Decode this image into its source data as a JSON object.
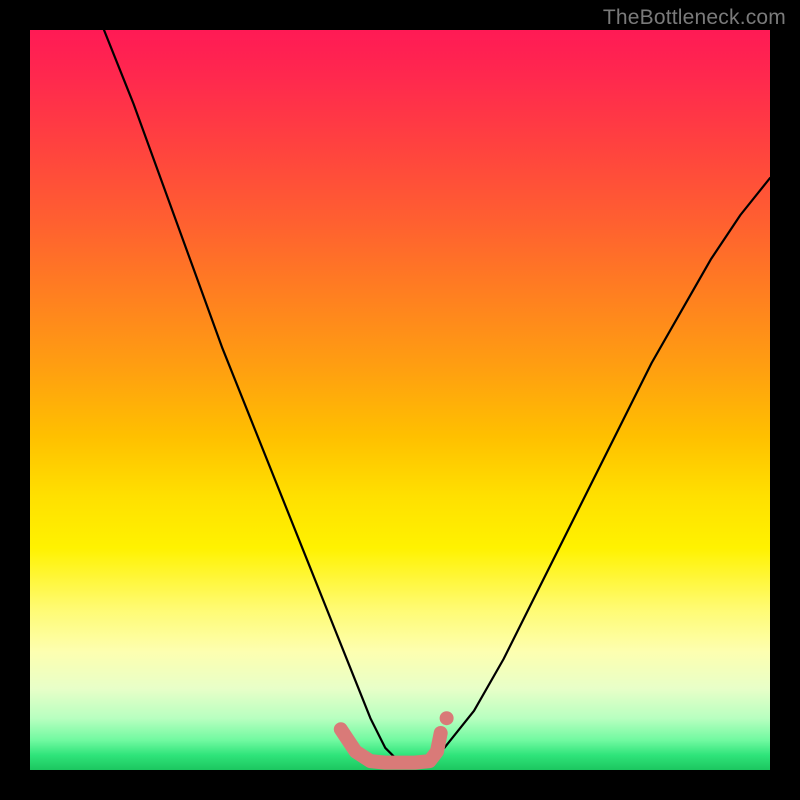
{
  "watermark": "TheBottleneck.com",
  "chart_data": {
    "type": "line",
    "title": "",
    "xlabel": "",
    "ylabel": "",
    "xlim": [
      0,
      100
    ],
    "ylim": [
      0,
      100
    ],
    "background_gradient": {
      "direction": "vertical",
      "stops": [
        {
          "t": 0.0,
          "color": "#ff1a55"
        },
        {
          "t": 0.15,
          "color": "#ff4040"
        },
        {
          "t": 0.36,
          "color": "#ff8020"
        },
        {
          "t": 0.55,
          "color": "#ffc000"
        },
        {
          "t": 0.7,
          "color": "#fff200"
        },
        {
          "t": 0.84,
          "color": "#fdffb0"
        },
        {
          "t": 0.93,
          "color": "#b8ffc0"
        },
        {
          "t": 1.0,
          "color": "#1cc65f"
        }
      ]
    },
    "series": [
      {
        "name": "bottleneck-curve",
        "color": "#000000",
        "x": [
          10,
          14,
          18,
          22,
          26,
          30,
          34,
          38,
          42,
          44,
          46,
          48,
          50,
          52,
          54,
          56,
          60,
          64,
          68,
          72,
          76,
          80,
          84,
          88,
          92,
          96,
          100
        ],
        "y": [
          100,
          90,
          79,
          68,
          57,
          47,
          37,
          27,
          17,
          12,
          7,
          3,
          1,
          1,
          2,
          3,
          8,
          15,
          23,
          31,
          39,
          47,
          55,
          62,
          69,
          75,
          80
        ]
      },
      {
        "name": "flat-bottom-marker",
        "color": "#d97a78",
        "stroke_width_px": 14,
        "x": [
          42,
          44,
          46,
          48,
          50,
          52,
          54,
          55,
          55.5
        ],
        "y": [
          5.5,
          2.5,
          1.2,
          1.0,
          1.0,
          1.0,
          1.2,
          2.5,
          5.0
        ]
      }
    ],
    "annotations": []
  }
}
